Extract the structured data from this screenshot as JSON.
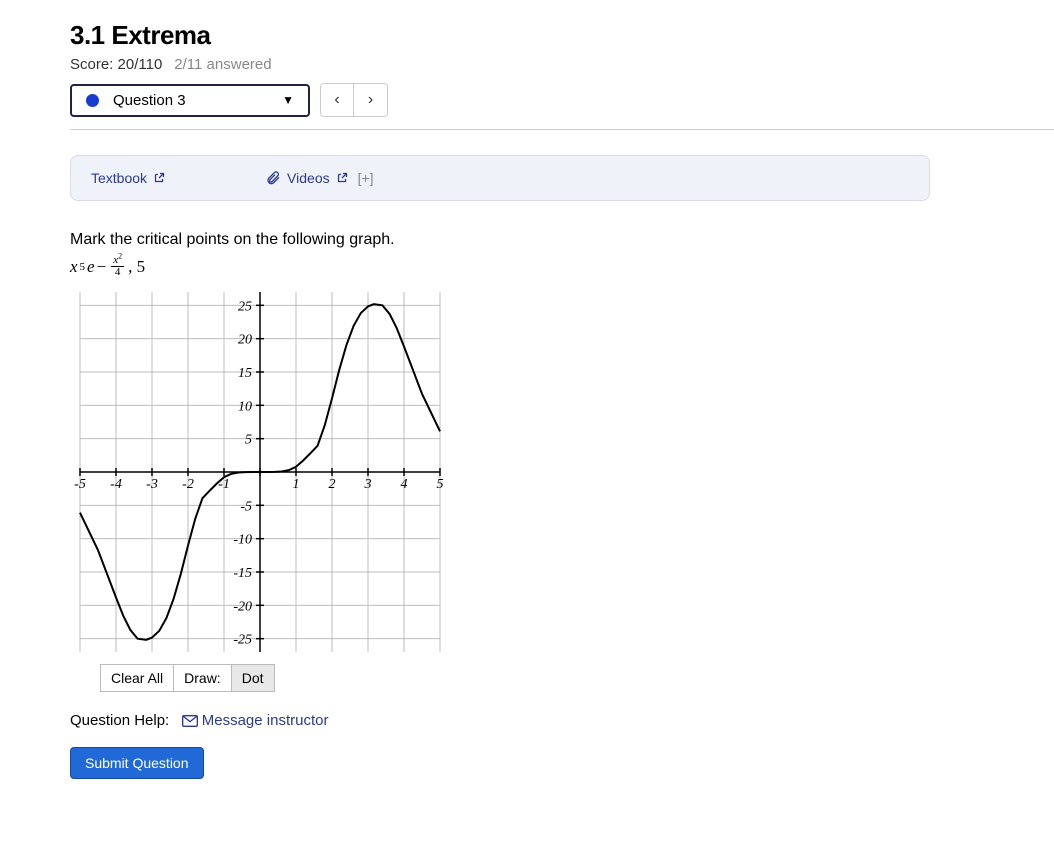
{
  "header": {
    "title": "3.1 Extrema",
    "score_label": "Score: 20/110",
    "answered_label": "2/11 answered"
  },
  "qbar": {
    "selected": "Question 3"
  },
  "resources": {
    "textbook": "Textbook",
    "videos": "Videos",
    "expand": "[+]"
  },
  "question": {
    "prompt": "Mark the critical points on the following graph.",
    "formula_plain": "x^5 e^{-x^2/4}, 5",
    "toolbar": {
      "clear": "Clear All",
      "draw_label": "Draw:",
      "tool": "Dot"
    },
    "help_label": "Question Help:",
    "message_instructor": "Message instructor",
    "submit": "Submit Question"
  },
  "chart_data": {
    "type": "line",
    "title": "",
    "xlabel": "",
    "ylabel": "",
    "xlim": [
      -5,
      5
    ],
    "ylim": [
      -27,
      27
    ],
    "xticks": [
      -5,
      -4,
      -3,
      -2,
      -1,
      1,
      2,
      3,
      4,
      5
    ],
    "yticks": [
      -25,
      -20,
      -15,
      -10,
      -5,
      5,
      10,
      15,
      20,
      25
    ],
    "series": [
      {
        "name": "x^5 e^{-x^2/4}",
        "x": [
          -5,
          -4.5,
          -4,
          -3.8,
          -3.6,
          -3.4,
          -3.162,
          -3,
          -2.8,
          -2.6,
          -2.4,
          -2.2,
          -2,
          -1.8,
          -1.6,
          -1.4,
          -1.2,
          -1,
          -0.8,
          -0.6,
          -0.4,
          -0.2,
          0,
          0.2,
          0.4,
          0.6,
          0.8,
          1,
          1.2,
          1.4,
          1.6,
          1.8,
          2,
          2.2,
          2.4,
          2.6,
          2.8,
          3,
          3.162,
          3.4,
          3.6,
          3.8,
          4,
          4.5,
          5
        ],
        "y": [
          -6.1,
          -11.73,
          -18.83,
          -21.55,
          -23.71,
          -25.01,
          -25.18,
          -24.84,
          -23.84,
          -21.92,
          -19.02,
          -15.29,
          -11.04,
          -7.03,
          -3.94,
          -2.81,
          -1.73,
          -0.78,
          -0.28,
          -0.07,
          -0.01,
          -0.0003,
          0,
          0.0003,
          0.01,
          0.07,
          0.28,
          0.78,
          1.73,
          2.81,
          3.94,
          7.03,
          11.04,
          15.29,
          19.02,
          21.92,
          23.84,
          24.84,
          25.18,
          25.01,
          23.71,
          21.55,
          18.83,
          11.73,
          6.1
        ]
      }
    ]
  }
}
